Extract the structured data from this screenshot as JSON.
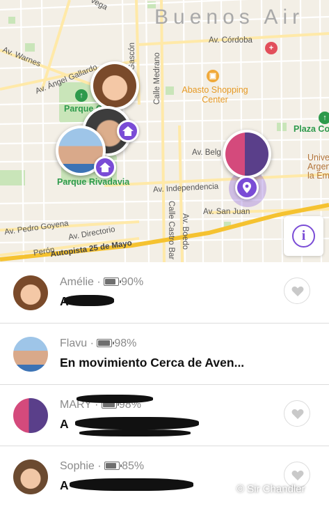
{
  "map": {
    "city": "Buenos Air",
    "streets": {
      "cordoba": "Av. Córdoba",
      "warnes": "Av. Warnes",
      "angel_gallardo": "Av. Ángel Gallardo",
      "gascon": "Calle Gascón",
      "medrano": "Calle Medrano",
      "belgrano": "Av. Belg",
      "independencia": "Av. Independencia",
      "san_juan": "Av. San Juan",
      "pedro_goyena": "Av. Pedro Goyena",
      "directorio": "Av. Directorio",
      "peron": "Perón",
      "autopista": "Autopista 25 de Mayo",
      "castro_barros": "Calle Castro Bar",
      "boedo": "Av. Boedo",
      "vega": "vega"
    },
    "places": {
      "parque_centenario": "Parque Cente",
      "abasto": "Abasto Shopping Center",
      "parque_rivadavia": "Parque Rivadavia",
      "plaza": "Plaza Co",
      "universidad": "Univer Argen la Em"
    },
    "info_glyph": "i",
    "accent_color": "#7a4cd6"
  },
  "members": [
    {
      "name": "Amélie",
      "battery": "90%",
      "battery_level": 0.9,
      "status": "A"
    },
    {
      "name": "Flavu",
      "battery": "98%",
      "battery_level": 0.98,
      "status": "En movimiento Cerca de Aven..."
    },
    {
      "name": "MARY",
      "battery": "98%",
      "battery_level": 0.98,
      "status": "A"
    },
    {
      "name": "Sophie",
      "battery": "85%",
      "battery_level": 0.85,
      "status": "A"
    }
  ],
  "separator": "·",
  "watermark": "© Sir Chandler"
}
